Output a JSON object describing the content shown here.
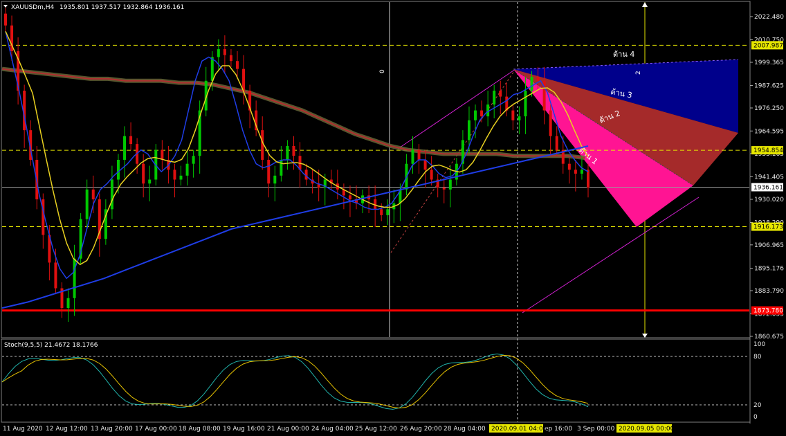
{
  "header": {
    "title": "XAUUSDm,H4",
    "ohlc": "1935.801 1937.517 1932.864 1936.161"
  },
  "stoch": {
    "title": "Stoch(9,5,5) 21.4672 18.1766",
    "ticks": [
      "100",
      "80",
      "20",
      "0"
    ]
  },
  "price_ticks": [
    "2022.480",
    "2010.750",
    "1999.365",
    "1987.625",
    "1976.250",
    "1964.595",
    "1953.165",
    "1941.405",
    "1930.020",
    "1918.290",
    "1906.965",
    "1895.176",
    "1883.790",
    "1872.055",
    "1860.675"
  ],
  "level_tags": {
    "l2007": "2007.987",
    "l1954": "1954.854",
    "l1936": "1936.161",
    "l1916": "1916.173",
    "l1873": "1873.780"
  },
  "time_labels": [
    "11 Aug 2020",
    "12 Aug 12:00",
    "13 Aug 20:00",
    "17 Aug 00:00",
    "18 Aug 08:00",
    "19 Aug 16:00",
    "21 Aug 00:00",
    "24 Aug 04:00",
    "25 Aug 12:00",
    "26 Aug 20:00",
    "28 Aug 04:00",
    "ep 16:00",
    "3 Sep 00:00"
  ],
  "time_markers": {
    "m1": "2020.09.01 04:00",
    "m2": "2020.09.05 00:00"
  },
  "zones": {
    "z1": "ต้าน 1",
    "z2": "ต้าน 2",
    "z3": "ต้าน 3",
    "z4": "ต้าน 4"
  },
  "fib_marks": {
    "zero": "0",
    "two": "2"
  },
  "colors": {
    "bull": "#00c800",
    "bear": "#e01010",
    "ma_blue": "#1f3de6",
    "ma_yellow": "#e8d020",
    "ma_red": "#b03030",
    "level_yellow": "#e6e600",
    "support_red": "#ff0000",
    "zone1": "#ff1493",
    "zone2": "#a52a2a",
    "zone3": "#00008b"
  },
  "chart_data": {
    "type": "candlestick",
    "symbol": "XAUUSDm",
    "timeframe": "H4",
    "ylim": [
      1860.675,
      2026
    ],
    "levels": [
      2007.987,
      1954.854,
      1936.161,
      1916.173,
      1873.78
    ],
    "closes": [
      2018,
      2005,
      1985,
      1965,
      1950,
      1930,
      1912,
      1898,
      1885,
      1875,
      1880,
      1900,
      1920,
      1935,
      1930,
      1910,
      1925,
      1940,
      1950,
      1962,
      1958,
      1948,
      1938,
      1940,
      1955,
      1950,
      1945,
      1940,
      1942,
      1948,
      1952,
      1975,
      1990,
      2002,
      2006,
      2003,
      2000,
      1996,
      1985,
      1975,
      1965,
      1950,
      1938,
      1942,
      1950,
      1957,
      1952,
      1945,
      1940,
      1938,
      1936,
      1940,
      1938,
      1935,
      1932,
      1930,
      1928,
      1932,
      1930,
      1925,
      1922,
      1925,
      1928,
      1935,
      1948,
      1955,
      1950,
      1945,
      1940,
      1936,
      1935,
      1940,
      1948,
      1960,
      1970,
      1975,
      1972,
      1978,
      1985,
      1982,
      1975,
      1970,
      1972,
      1985,
      1992,
      1990,
      1975,
      1962,
      1955,
      1948,
      1945,
      1943,
      1945,
      1936
    ],
    "ma_fast": [
      2015,
      2000,
      1985,
      1968,
      1950,
      1932,
      1918,
      1905,
      1895,
      1890,
      1893,
      1902,
      1915,
      1928,
      1935,
      1938,
      1942,
      1945,
      1948,
      1952,
      1955,
      1953,
      1948,
      1944,
      1947,
      1952,
      1960,
      1975,
      1990,
      2000,
      2002,
      2000,
      1996,
      1990,
      1978,
      1965,
      1955,
      1948,
      1946,
      1947,
      1949,
      1950,
      1950,
      1947,
      1943,
      1940,
      1938,
      1937,
      1935,
      1933,
      1931,
      1929,
      1928,
      1926,
      1925,
      1925,
      1926,
      1928,
      1933,
      1940,
      1947,
      1950,
      1950,
      1947,
      1943,
      1941,
      1942,
      1946,
      1953,
      1962,
      1970,
      1974,
      1976,
      1978,
      1980,
      1983,
      1984,
      1986,
      1988,
      1990,
      1984,
      1973,
      1962,
      1955,
      1950,
      1946,
      1944
    ],
    "ma_slow_blue": [
      1875,
      1878,
      1882,
      1886,
      1890,
      1895,
      1900,
      1905,
      1910,
      1915,
      1918,
      1921,
      1924,
      1927,
      1930,
      1933,
      1936,
      1939,
      1942,
      1945,
      1948,
      1951,
      1954,
      1957
    ],
    "ma_200": [
      1996,
      1995,
      1994,
      1993,
      1992,
      1991,
      1991,
      1990,
      1990,
      1990,
      1989,
      1989,
      1988,
      1986,
      1984,
      1981,
      1978,
      1975,
      1971,
      1967,
      1963,
      1960,
      1957,
      1955,
      1954,
      1953,
      1953,
      1953,
      1953,
      1952,
      1952,
      1952,
      1952,
      1951
    ]
  }
}
